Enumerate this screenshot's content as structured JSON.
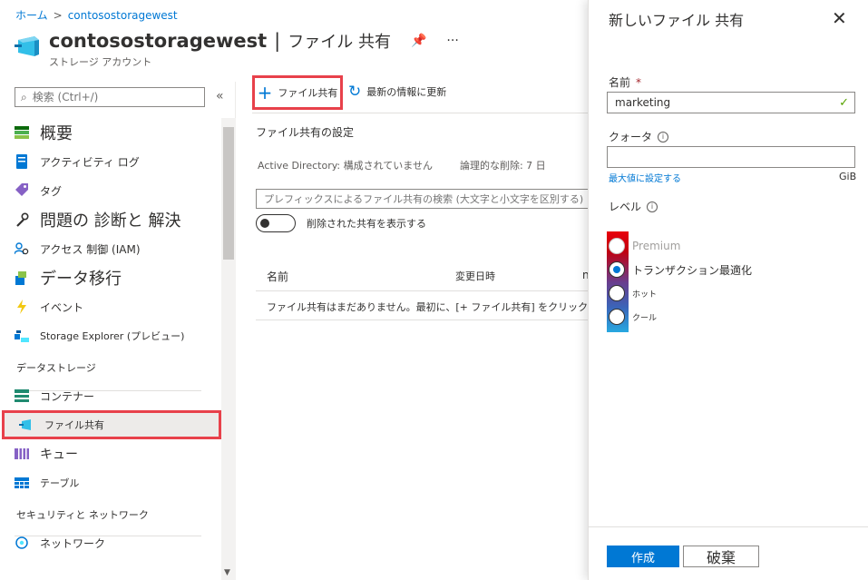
{
  "breadcrumb": {
    "home": "ホーム",
    "separator": ">",
    "resource": "contosostoragewest"
  },
  "header": {
    "resource_name": "contosostoragewest",
    "separator": "|",
    "page_name": "ファイル 共有",
    "pin": "📌",
    "more": "···",
    "subtitle": "ストレージ アカウント"
  },
  "sidebar": {
    "search_placeholder": "検索 (Ctrl+/)",
    "collapse": "«",
    "items": [
      {
        "label": "概要",
        "icon": "overview-icon"
      },
      {
        "label": "アクティビティ ログ",
        "icon": "activity-log-icon"
      },
      {
        "label": "タグ",
        "icon": "tag-icon"
      },
      {
        "label": "問題の 診断と 解決",
        "icon": "wrench-icon"
      },
      {
        "label": "アクセス 制御 (IAM)",
        "icon": "iam-icon"
      },
      {
        "label": "データ移行",
        "icon": "data-migration-icon"
      },
      {
        "label": "イベント",
        "icon": "events-icon"
      },
      {
        "label": "Storage Explorer (プレビュー)",
        "icon": "storage-explorer-icon"
      }
    ],
    "section_data": "データストレージ",
    "data_items": [
      {
        "label": "コンテナー",
        "icon": "container-icon"
      },
      {
        "label": "ファイル共有",
        "icon": "file-share-icon"
      },
      {
        "label": "キュー",
        "icon": "queue-icon"
      },
      {
        "label": "テーブル",
        "icon": "table-icon"
      }
    ],
    "section_security": "セキュリティと ネットワーク",
    "security_items": [
      {
        "label": "ネットワーク",
        "icon": "network-icon"
      }
    ]
  },
  "toolbar": {
    "add_label": "ファイル共有",
    "refresh_label": "最新の情報に更新"
  },
  "main": {
    "settings_title": "ファイル共有の設定",
    "ad_info": "Active  Directory: 構成されていません",
    "soft_delete": "論理的な削除: 7 日",
    "search_placeholder": "プレフィックスによるファイル共有の検索 (大文字と小文字を区別する)",
    "toggle_label": "削除された共有を表示する",
    "columns": [
      "名前",
      "変更日時",
      "n"
    ],
    "empty_message": "ファイル共有はまだありません。最初に、[+ ファイル共有] をクリックして"
  },
  "panel": {
    "title": "新しいファイル 共有",
    "close": "✕",
    "name_label": "名前",
    "required": "*",
    "name_value": "marketing",
    "quota_label": "クォータ",
    "max_link": "最大値に設定する",
    "unit": "GiB",
    "tier_label": "レベル",
    "tiers": [
      {
        "label": "Premium",
        "state": "disabled"
      },
      {
        "label": "トランザクション最適化",
        "state": "checked"
      },
      {
        "label": "ホット",
        "state": "unchecked"
      },
      {
        "label": "クール",
        "state": "unchecked"
      }
    ],
    "create": "作成",
    "discard": "破棄"
  },
  "colors": {
    "accent": "#0078d4",
    "highlight": "#e8414b",
    "valid": "#57a300"
  }
}
